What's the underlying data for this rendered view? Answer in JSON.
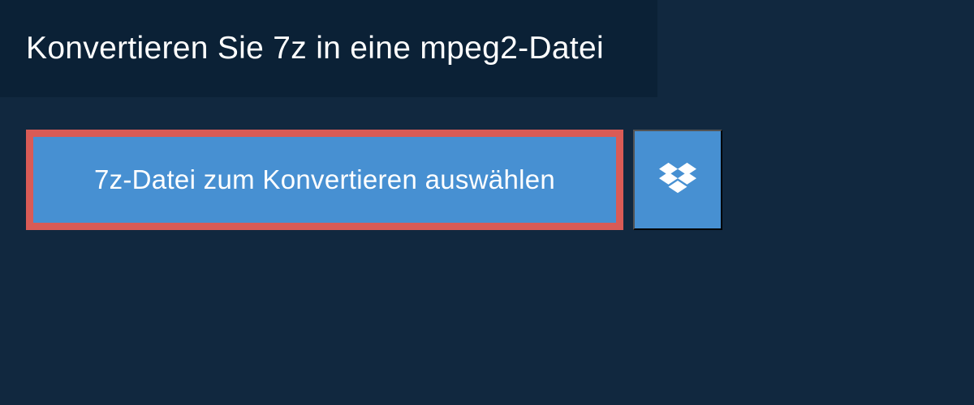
{
  "header": {
    "title": "Konvertieren Sie 7z in eine mpeg2-Datei"
  },
  "actions": {
    "select_file_label": "7z-Datei zum Konvertieren auswählen"
  },
  "colors": {
    "page_bg": "#11283f",
    "header_bg": "#0b2136",
    "button_bg": "#4790d2",
    "highlight_border": "#d95b56",
    "text": "#ffffff"
  }
}
